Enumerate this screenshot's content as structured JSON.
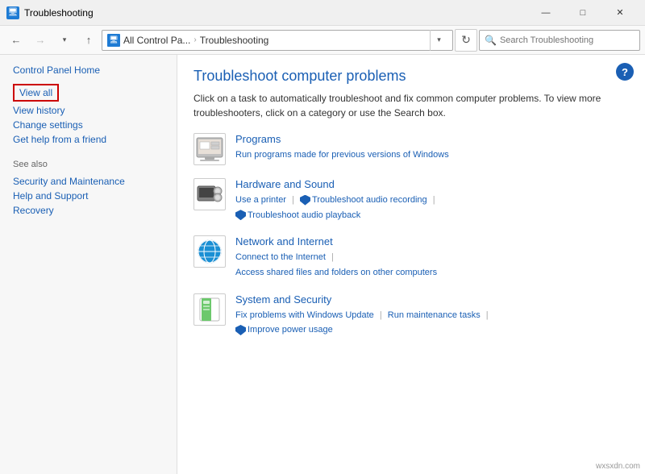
{
  "titlebar": {
    "icon_label": "🖥",
    "title": "Troubleshooting",
    "minimize_label": "—",
    "maximize_label": "□",
    "close_label": "✕"
  },
  "addressbar": {
    "back_label": "←",
    "forward_label": "→",
    "up_label": "↑",
    "address_icon": "🖥",
    "address_part1": "All Control Pa...",
    "address_separator": ">",
    "address_part2": "Troubleshooting",
    "search_placeholder": "Search Troubleshooting",
    "refresh_label": "↻"
  },
  "sidebar": {
    "home_label": "Control Panel Home",
    "view_all_label": "View all",
    "view_history_label": "View history",
    "change_settings_label": "Change settings",
    "get_help_label": "Get help from a friend",
    "see_also_label": "See also",
    "security_label": "Security and Maintenance",
    "help_support_label": "Help and Support",
    "recovery_label": "Recovery"
  },
  "content": {
    "title": "Troubleshoot computer problems",
    "description": "Click on a task to automatically troubleshoot and fix common computer problems. To view more troubleshooters, click on a category or use the Search box.",
    "categories": [
      {
        "id": "programs",
        "title": "Programs",
        "icon_type": "programs",
        "links": [
          {
            "label": "Run programs made for previous versions of Windows",
            "type": "link"
          }
        ]
      },
      {
        "id": "hardware-sound",
        "title": "Hardware and Sound",
        "icon_type": "hardware",
        "links": [
          {
            "label": "Use a printer",
            "type": "link"
          },
          {
            "label": "Troubleshoot audio recording",
            "type": "shield-link"
          },
          {
            "label": "Troubleshoot audio playback",
            "type": "shield-link"
          }
        ]
      },
      {
        "id": "network-internet",
        "title": "Network and Internet",
        "icon_type": "network",
        "links": [
          {
            "label": "Connect to the Internet",
            "type": "link"
          },
          {
            "label": "Access shared files and folders on other computers",
            "type": "link"
          }
        ]
      },
      {
        "id": "system-security",
        "title": "System and Security",
        "icon_type": "system",
        "links": [
          {
            "label": "Fix problems with Windows Update",
            "type": "link"
          },
          {
            "label": "Run maintenance tasks",
            "type": "link"
          },
          {
            "label": "Improve power usage",
            "type": "shield-link"
          }
        ]
      }
    ],
    "help_btn_label": "?"
  },
  "watermark": "wxsxdn.com"
}
